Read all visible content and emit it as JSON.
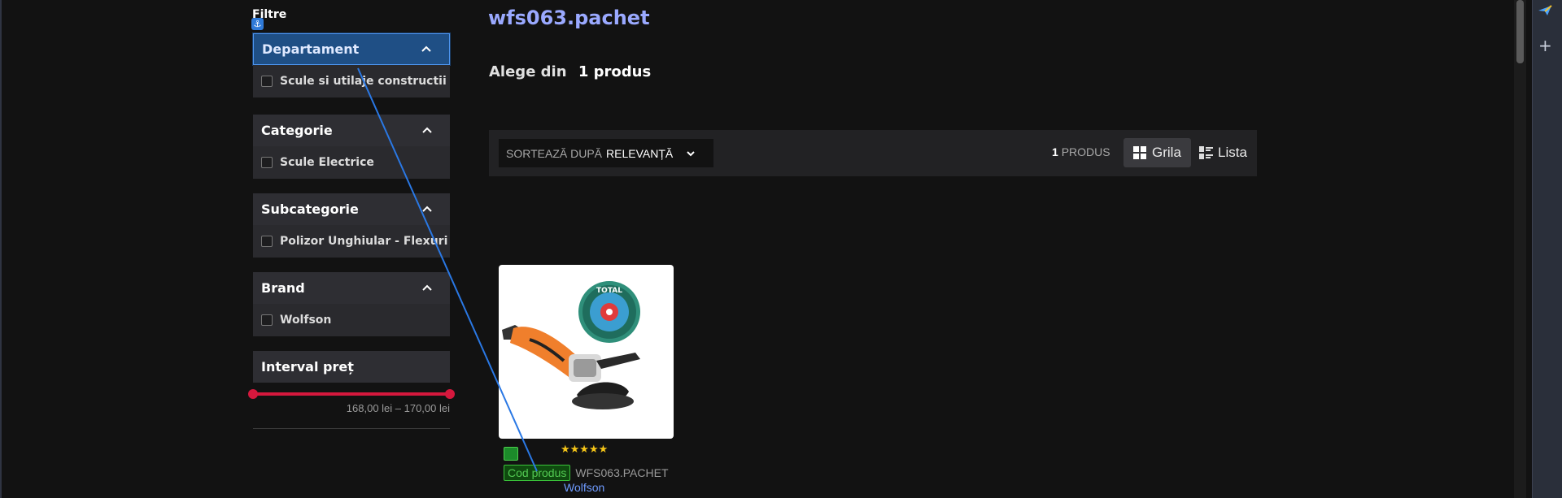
{
  "filters": {
    "title": "Filtre",
    "groups": [
      {
        "label": "Departament",
        "option": "Scule si utilaje constructii"
      },
      {
        "label": "Categorie",
        "option": "Scule Electrice"
      },
      {
        "label": "Subcategorie",
        "option": "Polizor Unghiular - Flexuri"
      },
      {
        "label": "Brand",
        "option": "Wolfson"
      }
    ],
    "price": {
      "label": "Interval preț",
      "range": "168,00 lei – 170,00 lei"
    }
  },
  "main": {
    "title": "wfs063.pachet",
    "choose_label": "Alege din",
    "choose_count": "1 produs"
  },
  "toolbar": {
    "sort_prefix": "SORTEAZĂ DUPĂ",
    "sort_value": "RELEVANȚĂ",
    "count_number": "1",
    "count_label": "PRODUS",
    "grid_label": "Grila",
    "list_label": "Lista"
  },
  "product": {
    "stars": "★★★★★",
    "rating_fraction": 1.0,
    "code_label": "Cod produs",
    "code_value": "WFS063.PACHET",
    "brand": "Wolfson",
    "disc_brand": "TOTAL"
  },
  "colors": {
    "accent_title": "#9aa9ff",
    "slider": "#d5183d",
    "brand_link": "#6f9bff",
    "code_badge": "#52c952"
  }
}
